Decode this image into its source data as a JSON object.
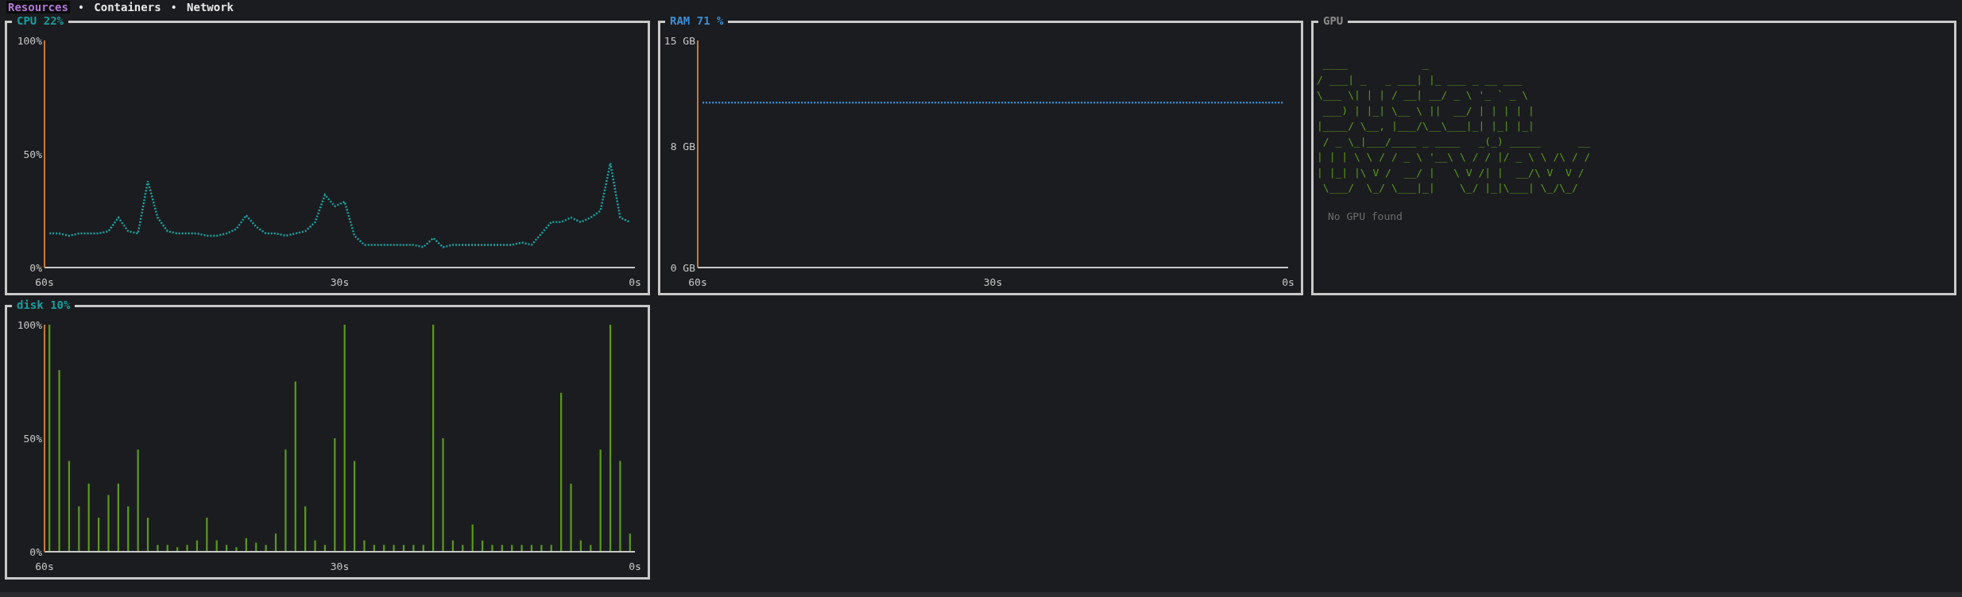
{
  "tabs": [
    {
      "label": "Resources",
      "selected": true
    },
    {
      "label": "Containers",
      "selected": false
    },
    {
      "label": "Network",
      "selected": false
    }
  ],
  "tab_separators": [
    "•",
    "•"
  ],
  "panels": [
    {
      "kind": "chart",
      "title": "CPU 22%",
      "chart_data": {
        "type": "line",
        "x": [
          59.5,
          58.5,
          57.5,
          56.5,
          55.5,
          54.5,
          53.5,
          52.5,
          51.5,
          50.5,
          49.5,
          48.5,
          47.5,
          46.5,
          45.5,
          44.5,
          43.5,
          42.5,
          41.5,
          40.5,
          39.5,
          38.5,
          37.5,
          36.5,
          35.5,
          34.5,
          33.5,
          32.5,
          31.5,
          30.5,
          29.5,
          28.5,
          27.5,
          26.5,
          25.5,
          24.5,
          23.5,
          22.5,
          21.5,
          20.5,
          19.5,
          18.5,
          17.5,
          16.5,
          15.5,
          14.5,
          13.5,
          12.5,
          11.5,
          10.5,
          9.5,
          8.5,
          7.5,
          6.5,
          5.5,
          4.5,
          3.5,
          2.5,
          1.5,
          0.5
        ],
        "xlim": [
          60,
          0
        ],
        "ylim": [
          0,
          100
        ],
        "xticks": [
          {
            "value": 60,
            "label": "60s"
          },
          {
            "value": 30,
            "label": "30s"
          },
          {
            "value": 0,
            "label": "0s"
          }
        ],
        "yticks": [
          {
            "value": 0,
            "label": "0%"
          },
          {
            "value": 50,
            "label": "50%"
          },
          {
            "value": 100,
            "label": "100%"
          }
        ],
        "series": [
          {
            "color": "#1aa6a6",
            "line_style": "dotted",
            "values": [
              15,
              15,
              14,
              15,
              15,
              15,
              16,
              22,
              16,
              15,
              38,
              22,
              16,
              15,
              15,
              15,
              14,
              14,
              15,
              17,
              23,
              18,
              15,
              15,
              14,
              15,
              16,
              20,
              32,
              27,
              29,
              14,
              10,
              10,
              10,
              10,
              10,
              10,
              9,
              13,
              9,
              10,
              10,
              10,
              10,
              10,
              10,
              10,
              11,
              10,
              15,
              20,
              20,
              22,
              20,
              22,
              25,
              46,
              22,
              20
            ]
          }
        ]
      }
    },
    {
      "kind": "chart",
      "title": "RAM 71 %",
      "chart_data": {
        "type": "line",
        "x": [
          59.5,
          58.5,
          57.5,
          56.5,
          55.5,
          54.5,
          53.5,
          52.5,
          51.5,
          50.5,
          49.5,
          48.5,
          47.5,
          46.5,
          45.5,
          44.5,
          43.5,
          42.5,
          41.5,
          40.5,
          39.5,
          38.5,
          37.5,
          36.5,
          35.5,
          34.5,
          33.5,
          32.5,
          31.5,
          30.5,
          29.5,
          28.5,
          27.5,
          26.5,
          25.5,
          24.5,
          23.5,
          22.5,
          21.5,
          20.5,
          19.5,
          18.5,
          17.5,
          16.5,
          15.5,
          14.5,
          13.5,
          12.5,
          11.5,
          10.5,
          9.5,
          8.5,
          7.5,
          6.5,
          5.5,
          4.5,
          3.5,
          2.5,
          1.5,
          0.5
        ],
        "xlim": [
          60,
          0
        ],
        "ylim": [
          0,
          15
        ],
        "xticks": [
          {
            "value": 60,
            "label": "60s"
          },
          {
            "value": 30,
            "label": "30s"
          },
          {
            "value": 0,
            "label": "0s"
          }
        ],
        "yticks": [
          {
            "value": 0,
            "label": "0 GB"
          },
          {
            "value": 8,
            "label": "8 GB"
          },
          {
            "value": 15,
            "label": "15 GB"
          }
        ],
        "series": [
          {
            "color": "#3a8fd6",
            "line_style": "dotted",
            "values": [
              10.9,
              10.9,
              10.9,
              10.9,
              10.9,
              10.9,
              10.9,
              10.9,
              10.9,
              10.9,
              10.9,
              10.9,
              10.9,
              10.9,
              10.9,
              10.9,
              10.9,
              10.9,
              10.9,
              10.9,
              10.9,
              10.9,
              10.9,
              10.9,
              10.9,
              10.9,
              10.9,
              10.9,
              10.9,
              10.9,
              10.9,
              10.9,
              10.9,
              10.9,
              10.9,
              10.9,
              10.9,
              10.9,
              10.9,
              10.9,
              10.9,
              10.9,
              10.9,
              10.9,
              10.9,
              10.9,
              10.9,
              10.9,
              10.9,
              10.9,
              10.9,
              10.9,
              10.9,
              10.9,
              10.9,
              10.9,
              10.9,
              10.9,
              10.9,
              10.9
            ]
          }
        ]
      }
    },
    {
      "kind": "banner",
      "title": "GPU",
      "art": [
        " ____            _",
        "/ ___| _   _ ___| |_ ___ _ __ ___",
        "\\___ \\| | | / __| __/ _ \\ '_ ` _ \\",
        " ___) | |_| \\__ \\ ||  __/ | | | | |",
        "|____/ \\__, |___/\\__\\___|_| |_| |_|",
        " / _ \\_|___/____ _ ____   _(_) _____      __",
        "| | | \\ \\ / / _ \\ '__\\ \\ / / |/ _ \\ \\ /\\ / /",
        "| |_| |\\ V /  __/ |   \\ V /| |  __/\\ V  V /",
        " \\___/  \\_/ \\___|_|    \\_/ |_|\\___| \\_/\\_/"
      ],
      "message": "No GPU found"
    },
    {
      "kind": "chart",
      "title": "disk 10%",
      "chart_data": {
        "type": "bar",
        "x": [
          59.5,
          58.5,
          57.5,
          56.5,
          55.5,
          54.5,
          53.5,
          52.5,
          51.5,
          50.5,
          49.5,
          48.5,
          47.5,
          46.5,
          45.5,
          44.5,
          43.5,
          42.5,
          41.5,
          40.5,
          39.5,
          38.5,
          37.5,
          36.5,
          35.5,
          34.5,
          33.5,
          32.5,
          31.5,
          30.5,
          29.5,
          28.5,
          27.5,
          26.5,
          25.5,
          24.5,
          23.5,
          22.5,
          21.5,
          20.5,
          19.5,
          18.5,
          17.5,
          16.5,
          15.5,
          14.5,
          13.5,
          12.5,
          11.5,
          10.5,
          9.5,
          8.5,
          7.5,
          6.5,
          5.5,
          4.5,
          3.5,
          2.5,
          1.5,
          0.5
        ],
        "xlim": [
          60,
          0
        ],
        "ylim": [
          0,
          100
        ],
        "xticks": [
          {
            "value": 60,
            "label": "60s"
          },
          {
            "value": 30,
            "label": "30s"
          },
          {
            "value": 0,
            "label": "0s"
          }
        ],
        "yticks": [
          {
            "value": 0,
            "label": "0%"
          },
          {
            "value": 50,
            "label": "50%"
          },
          {
            "value": 100,
            "label": "100%"
          }
        ],
        "series": [
          {
            "color": "#5a9a1e",
            "values": [
              100,
              80,
              40,
              20,
              30,
              15,
              25,
              30,
              20,
              45,
              15,
              3,
              3,
              2,
              3,
              5,
              15,
              5,
              3,
              2,
              6,
              4,
              3,
              8,
              45,
              75,
              20,
              5,
              3,
              50,
              100,
              40,
              5,
              3,
              3,
              3,
              3,
              3,
              3,
              100,
              50,
              5,
              3,
              12,
              5,
              3,
              3,
              3,
              3,
              3,
              3,
              3,
              70,
              30,
              5,
              3,
              45,
              100,
              40,
              8
            ]
          }
        ]
      }
    }
  ]
}
